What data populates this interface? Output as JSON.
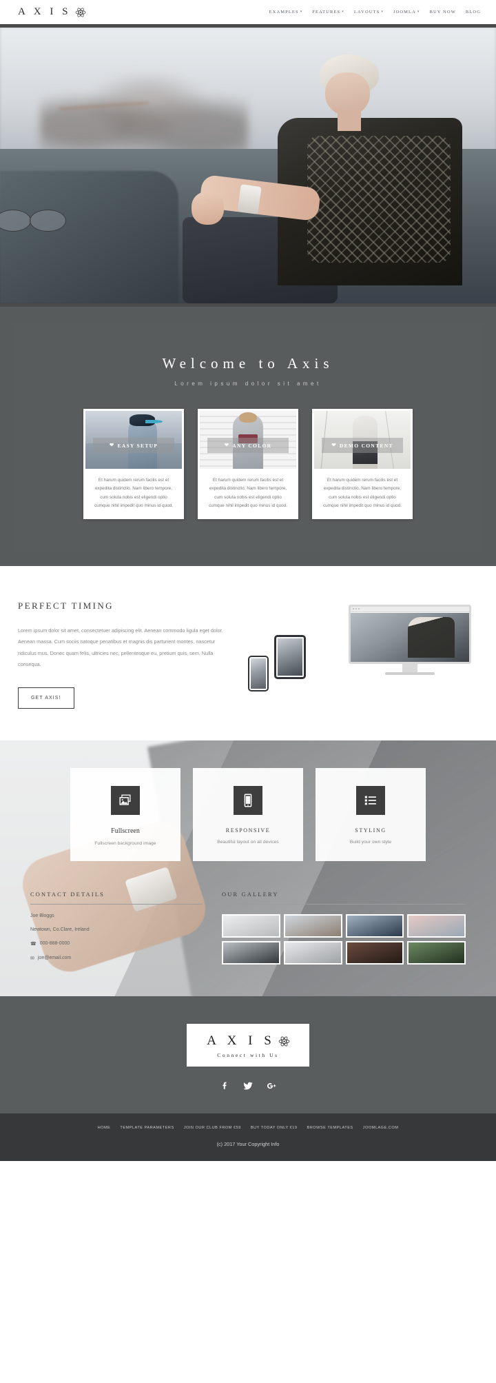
{
  "header": {
    "brand": "A X I S",
    "brand_icon": "atom-icon",
    "nav": [
      {
        "label": "EXAMPLES",
        "caret": "▾"
      },
      {
        "label": "FEATURES",
        "caret": "▾"
      },
      {
        "label": "LAYOUTS",
        "caret": "▾"
      },
      {
        "label": "JOOMLA",
        "caret": "▾"
      },
      {
        "label": "BUY NOW",
        "caret": ""
      },
      {
        "label": "BLOG",
        "caret": ""
      }
    ]
  },
  "welcome": {
    "title": "Welcome to Axis",
    "subtitle": "Lorem ipsum dolor sit amet",
    "cards": [
      {
        "badge": "EASY SETUP",
        "icon": "heart-icon",
        "body": "Et harum quidem rerum facilis est et expedita distinctio. Nam libero tempore, cum soluta nobis est eligendi optio cumque nihil impedit quo minus id quod."
      },
      {
        "badge": "ANY COLOR",
        "icon": "heart-icon",
        "body": "Et harum quidem rerum facilis est et expedita distinctio. Nam libero tempore, cum soluta nobis est eligendi optio cumque nihil impedit quo minus id quod."
      },
      {
        "badge": "DEMO CONTENT",
        "icon": "heart-icon",
        "body": "Et harum quidem rerum facilis est et expedita distinctio. Nam libero tempore, cum soluta nobis est eligendi optio cumque nihil impedit quo minus id quod."
      }
    ]
  },
  "timing": {
    "title": "PERFECT TIMING",
    "paragraph": "Lorem ipsum dolor sit amet, consectetuer adipiscing elit. Aenean commodo ligula eget dolor. Aenean massa. Cum sociis natoque penatibus et magnis dis parturient montes, nascetur ridiculus mus. Donec quam felis, ultricies nec, pellentesque eu, pretium quis, sem. Nulla consequa.",
    "button": "GET AXIS!"
  },
  "features": [
    {
      "icon": "images-icon",
      "title": "Fullscreen",
      "desc": "Fullscreen background image",
      "caps": false
    },
    {
      "icon": "tablet-icon",
      "title": "RESPONSIVE",
      "desc": "Beautiful layout on all devices",
      "caps": true
    },
    {
      "icon": "list-icon",
      "title": "STYLING",
      "desc": "Build your own style",
      "caps": true
    }
  ],
  "contact": {
    "heading": "CONTACT DETAILS",
    "name": "Joe Bloggs",
    "address": "Newtown, Co.Clare, Ireland",
    "phone": "000-888-0000",
    "phone_icon": "phone-icon",
    "email": "joe@email.com",
    "email_icon": "envelope-icon"
  },
  "gallery": {
    "heading": "OUR GALLERY",
    "items": [
      "g1",
      "g2",
      "g3",
      "g4",
      "g5",
      "g6",
      "g7",
      "g8"
    ]
  },
  "connect": {
    "brand": "A X I S",
    "brand_icon": "atom-icon",
    "tagline": "Connect with Us",
    "socials": [
      {
        "name": "facebook-icon",
        "glyph": "f"
      },
      {
        "name": "twitter-icon",
        "glyph": "t"
      },
      {
        "name": "google-plus-icon",
        "glyph": "G+"
      }
    ]
  },
  "footer": {
    "links": [
      "HOME",
      "TEMPLATE PARAMETERS",
      "JOIN OUR CLUB FROM €59",
      "BUY TODAY ONLY €19",
      "BROWSE TEMPLATES",
      "JOOMLAGE.COM"
    ],
    "copyright": "(c) 2017 Your Copyright Info"
  },
  "colors": {
    "dark_rule": "#4b4b4b",
    "welcome_bg": "#585b5c",
    "connect_bg": "#5a5d5e",
    "footer_bg": "#36383a",
    "icon_bg": "#3e3e3e"
  }
}
